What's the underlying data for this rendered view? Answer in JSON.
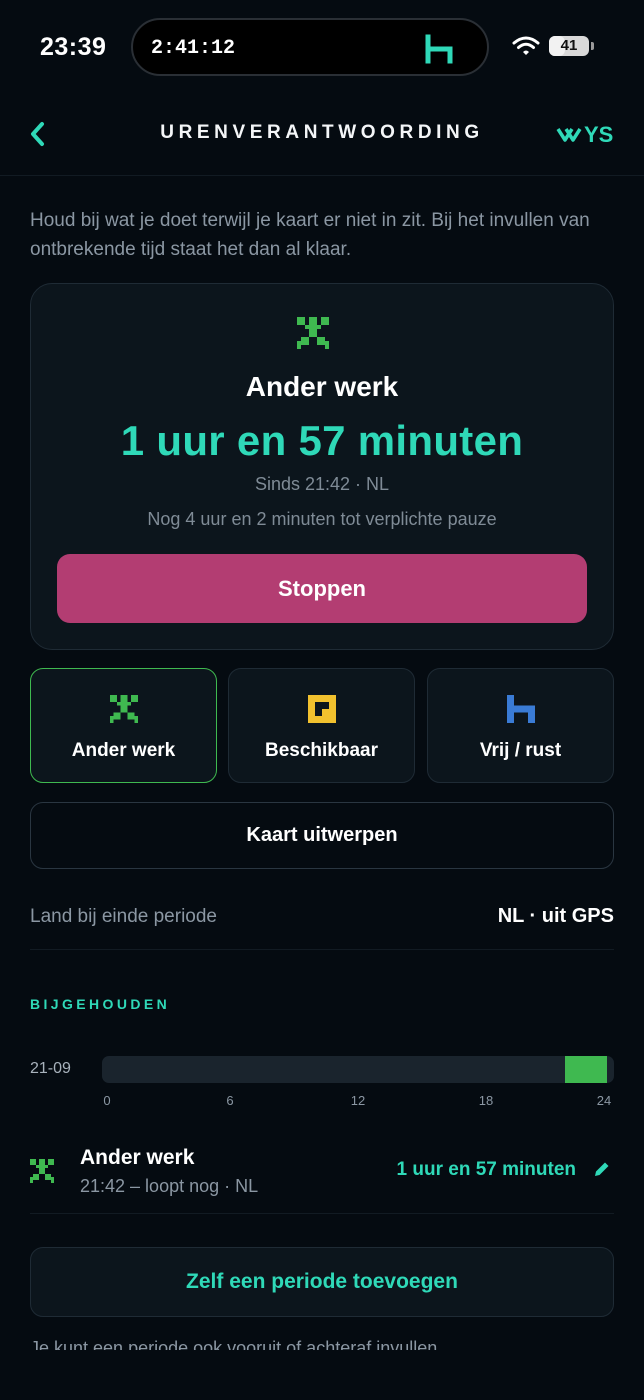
{
  "status_bar": {
    "time": "23:39",
    "live_activity_timer": "2:41:12",
    "battery_level": "41",
    "battery_fraction": 0.41,
    "island_logo_icon": "h-logo-icon",
    "wifi_icon": "wifi-icon"
  },
  "nav": {
    "back_icon": "chevron-left-icon",
    "title": "URENVERANTWOORDING",
    "brand": "YS"
  },
  "intro_text": "Houd bij wat je doet terwijl je kaart er niet in zit. Bij het invullen van ontbrekende tijd staat het dan al klaar.",
  "current": {
    "icon": "hammers-icon",
    "activity": "Ander werk",
    "duration": "1 uur en 57 minuten",
    "since": "Sinds 21:42 · NL",
    "pause_notice": "Nog 4 uur en 2 minuten tot verplichte pauze",
    "stop_label": "Stoppen"
  },
  "activities": [
    {
      "label": "Ander werk",
      "icon": "hammers-icon",
      "selected": true
    },
    {
      "label": "Beschikbaar",
      "icon": "square-icon",
      "selected": false
    },
    {
      "label": "Vrij / rust",
      "icon": "bed-icon",
      "selected": false
    }
  ],
  "eject_label": "Kaart uitwerpen",
  "country": {
    "label": "Land bij einde periode",
    "value": "NL · uit GPS"
  },
  "tracked": {
    "section_title": "BIJGEHOUDEN",
    "chart_data": {
      "type": "bar",
      "date": "21-09",
      "x_ticks": [
        "0",
        "6",
        "12",
        "18",
        "24"
      ],
      "xlim": [
        0,
        24
      ],
      "segments": [
        {
          "start": 21.7,
          "end": 23.65,
          "activity": "Ander werk",
          "color": "#3fb950"
        }
      ]
    },
    "entries": [
      {
        "icon": "hammers-icon",
        "title": "Ander werk",
        "subtitle": "21:42 – loopt nog · NL",
        "duration": "1 uur en 57 minuten",
        "edit_icon": "pencil-icon"
      }
    ]
  },
  "add_period_label": "Zelf een periode toevoegen",
  "footnote": "Je kunt een periode ook vooruit of achteraf invullen.",
  "colors": {
    "background": "#050b11",
    "accent": "#2fd9b8",
    "stop": "#b33d72",
    "work": "#3fb950",
    "available": "#f2c12e",
    "rest": "#3a7bd5"
  }
}
